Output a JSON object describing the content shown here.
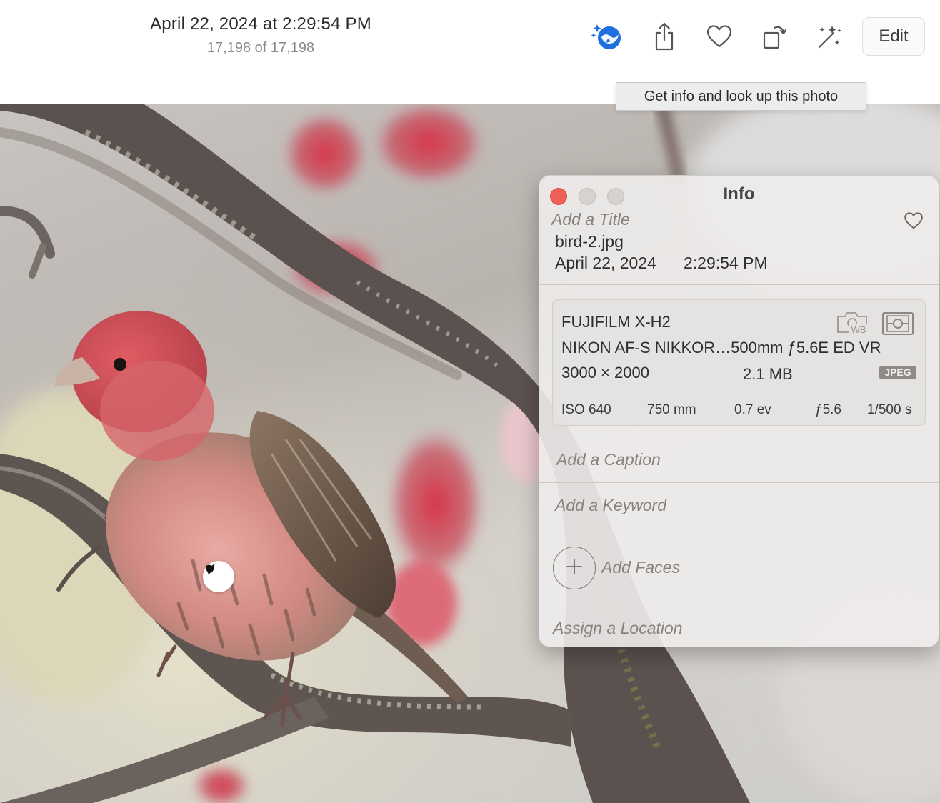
{
  "toolbar": {
    "title": "April 22, 2024 at 2:29:54 PM",
    "count": "17,198 of 17,198",
    "icons": [
      "visual-look-up-icon",
      "share-icon",
      "heart-icon",
      "rotate-icon",
      "auto-enhance-icon"
    ],
    "edit_label": "Edit",
    "tooltip": "Get info and look up this photo",
    "accent_color": "#1f6fe0"
  },
  "photo": {
    "visual_lookup_badge_icon": "bird-icon"
  },
  "info_panel": {
    "title": "Info",
    "title_placeholder": "Add a Title",
    "filename": "bird-2.jpg",
    "date": "April 22, 2024",
    "time": "2:29:54 PM",
    "camera": {
      "model": "FUJIFILM X-H2",
      "lens": "NIKON AF-S NIKKOR…500mm ƒ5.6E ED VR",
      "dimensions": "3000 × 2000",
      "file_size": "2.1 MB",
      "format": "JPEG",
      "wb_icon_text": "WB",
      "exif": {
        "iso": "ISO 640",
        "focal_length": "750 mm",
        "exposure": "0.7 ev",
        "aperture": "ƒ5.6",
        "shutter": "1/500 s"
      }
    },
    "caption_placeholder": "Add a Caption",
    "keyword_placeholder": "Add a Keyword",
    "faces_label": "Add Faces",
    "location_placeholder": "Assign a Location",
    "close_color": "#ed5f57"
  }
}
